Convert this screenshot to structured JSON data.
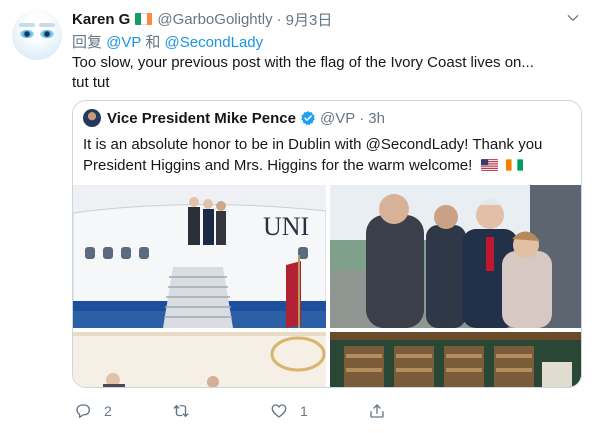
{
  "tweet": {
    "author": {
      "display_name": "Karen G",
      "flag_icon": "ireland-flag-icon",
      "handle": "@GarboGolightly",
      "separator": "·",
      "date": "9月3日"
    },
    "reply_to": {
      "prefix": "回复",
      "user1": "@VP",
      "conjunction": "和",
      "user2": "@SecondLady"
    },
    "text_line1": "Too slow, your previous post with the flag of the Ivory Coast lives on...",
    "text_line2": "tut tut",
    "quoted": {
      "display_name": "Vice President Mike Pence",
      "verified_icon": "verified-badge-icon",
      "handle": "@VP",
      "separator": "·",
      "time": "3h",
      "text_line1": "It is an absolute honor to be in Dublin with @SecondLady! Thank you",
      "text_line2": "President Higgins and Mrs. Higgins  for the warm welcome!",
      "emoji_flags": [
        "us-flag-icon",
        "ivory-coast-flag-icon"
      ],
      "media_count": 4
    },
    "actions": {
      "reply_count": "2",
      "retweet_count": "",
      "like_count": "1",
      "share_count": ""
    },
    "colors": {
      "link": "#1b95e0",
      "secondary_text": "#657786",
      "border": "#ccd6dd",
      "verified": "#1da1f2",
      "ireland_flag": [
        "#169b62",
        "#ffffff",
        "#ff883e"
      ],
      "ivory_coast_flag": [
        "#f77f00",
        "#ffffff",
        "#009e60"
      ]
    }
  }
}
